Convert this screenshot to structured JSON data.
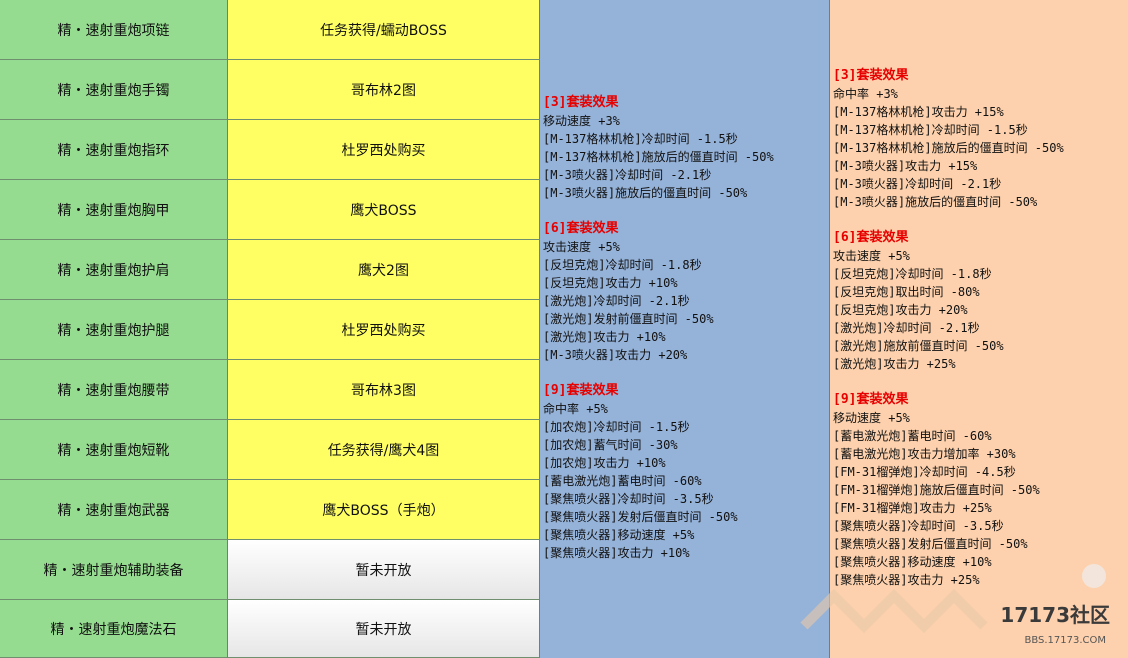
{
  "rows": [
    {
      "name": "精・速射重炮项链",
      "source": "任务获得/蠕动BOSS",
      "open": true
    },
    {
      "name": "精・速射重炮手镯",
      "source": "哥布林2图",
      "open": true
    },
    {
      "name": "精・速射重炮指环",
      "source": "杜罗西处购买",
      "open": true
    },
    {
      "name": "精・速射重炮胸甲",
      "source": "鹰犬BOSS",
      "open": true
    },
    {
      "name": "精・速射重炮护肩",
      "source": "鹰犬2图",
      "open": true
    },
    {
      "name": "精・速射重炮护腿",
      "source": "杜罗西处购买",
      "open": true
    },
    {
      "name": "精・速射重炮腰带",
      "source": "哥布林3图",
      "open": true
    },
    {
      "name": "精・速射重炮短靴",
      "source": "任务获得/鹰犬4图",
      "open": true
    },
    {
      "name": "精・速射重炮武器",
      "source": "鹰犬BOSS（手炮）",
      "open": true
    },
    {
      "name": "精・速射重炮辅助装备",
      "source": "暂未开放",
      "open": false
    },
    {
      "name": "精・速射重炮魔法石",
      "source": "暂未开放",
      "open": false
    }
  ],
  "set_blue": [
    {
      "title": "[3]套装效果",
      "lines": [
        "移动速度 +3%",
        "[M-137格林机枪]冷却时间 -1.5秒",
        "[M-137格林机枪]施放后的僵直时间 -50%",
        "[M-3喷火器]冷却时间 -2.1秒",
        "[M-3喷火器]施放后的僵直时间 -50%"
      ]
    },
    {
      "title": "[6]套装效果",
      "lines": [
        "攻击速度 +5%",
        "[反坦克炮]冷却时间 -1.8秒",
        "[反坦克炮]攻击力 +10%",
        "[激光炮]冷却时间 -2.1秒",
        "[激光炮]发射前僵直时间 -50%",
        "[激光炮]攻击力 +10%",
        "[M-3喷火器]攻击力 +20%"
      ]
    },
    {
      "title": "[9]套装效果",
      "lines": [
        "命中率 +5%",
        "[加农炮]冷却时间 -1.5秒",
        "[加农炮]蓄气时间 -30%",
        "[加农炮]攻击力 +10%",
        "[蓄电激光炮]蓄电时间 -60%",
        "[聚焦喷火器]冷却时间 -3.5秒",
        "[聚焦喷火器]发射后僵直时间 -50%",
        "[聚焦喷火器]移动速度 +5%",
        "[聚焦喷火器]攻击力 +10%"
      ]
    }
  ],
  "set_peach": [
    {
      "title": "[3]套装效果",
      "lines": [
        "命中率 +3%",
        "[M-137格林机枪]攻击力 +15%",
        "[M-137格林机枪]冷却时间 -1.5秒",
        "[M-137格林机枪]施放后的僵直时间 -50%",
        "[M-3喷火器]攻击力 +15%",
        "[M-3喷火器]冷却时间 -2.1秒",
        "[M-3喷火器]施放后的僵直时间 -50%"
      ]
    },
    {
      "title": "[6]套装效果",
      "lines": [
        "攻击速度 +5%",
        "[反坦克炮]冷却时间 -1.8秒",
        "[反坦克炮]取出时间 -80%",
        "[反坦克炮]攻击力 +20%",
        "[激光炮]冷却时间 -2.1秒",
        "[激光炮]施放前僵直时间 -50%",
        "[激光炮]攻击力 +25%"
      ]
    },
    {
      "title": "[9]套装效果",
      "lines": [
        "移动速度 +5%",
        "[蓄电激光炮]蓄电时间 -60%",
        "[蓄电激光炮]攻击力增加率 +30%",
        "[FM-31榴弹炮]冷却时间 -4.5秒",
        "[FM-31榴弹炮]施放后僵直时间 -50%",
        "[FM-31榴弹炮]攻击力 +25%",
        "[聚焦喷火器]冷却时间 -3.5秒",
        "[聚焦喷火器]发射后僵直时间 -50%",
        "[聚焦喷火器]移动速度 +10%",
        "[聚焦喷火器]攻击力 +25%"
      ]
    }
  ],
  "watermark": {
    "text": "17173社区",
    "sub": "BBS.17173.COM"
  },
  "colors": {
    "name_col": "#96dc90",
    "source_col": "#ffff63",
    "blue_panel": "#95b2d8",
    "peach_panel": "#fdd1ad",
    "tier_title": "#e60000"
  }
}
